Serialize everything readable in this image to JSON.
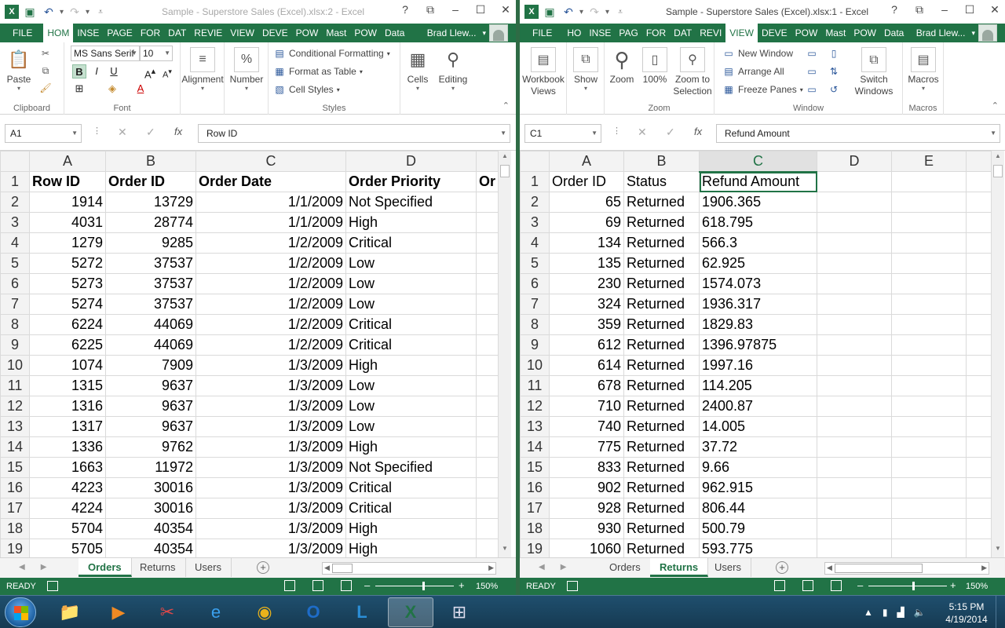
{
  "left": {
    "title": "Sample - Superstore Sales (Excel).xlsx:2 - Excel",
    "user": "Brad Llew...",
    "tabs": [
      "FILE",
      "HOM",
      "INSE",
      "PAGE",
      "FOR",
      "DAT",
      "REVIE",
      "VIEW",
      "DEVE",
      "POW",
      "Mast",
      "POW",
      "Data"
    ],
    "active_tab": "HOM",
    "ribbon": {
      "paste": "Paste",
      "clipboard": "Clipboard",
      "font_name": "MS Sans Serif",
      "font_size": "10",
      "bold": "B",
      "italic": "I",
      "underline": "U",
      "font_group": "Font",
      "alignment": "Alignment",
      "number": "Number",
      "percent": "%",
      "conditional": "Conditional Formatting",
      "format_table": "Format as Table",
      "cell_styles": "Cell Styles",
      "styles_group": "Styles",
      "cells": "Cells",
      "editing": "Editing"
    },
    "name_box": "A1",
    "formula": "Row ID",
    "columns": [
      "A",
      "B",
      "C",
      "D",
      "Or"
    ],
    "header_row": [
      "Row ID",
      "Order ID",
      "Order Date",
      "Order Priority",
      "Or"
    ],
    "rows": [
      [
        "1914",
        "13729",
        "1/1/2009",
        "Not Specified"
      ],
      [
        "4031",
        "28774",
        "1/1/2009",
        "High"
      ],
      [
        "1279",
        "9285",
        "1/2/2009",
        "Critical"
      ],
      [
        "5272",
        "37537",
        "1/2/2009",
        "Low"
      ],
      [
        "5273",
        "37537",
        "1/2/2009",
        "Low"
      ],
      [
        "5274",
        "37537",
        "1/2/2009",
        "Low"
      ],
      [
        "6224",
        "44069",
        "1/2/2009",
        "Critical"
      ],
      [
        "6225",
        "44069",
        "1/2/2009",
        "Critical"
      ],
      [
        "1074",
        "7909",
        "1/3/2009",
        "High"
      ],
      [
        "1315",
        "9637",
        "1/3/2009",
        "Low"
      ],
      [
        "1316",
        "9637",
        "1/3/2009",
        "Low"
      ],
      [
        "1317",
        "9637",
        "1/3/2009",
        "Low"
      ],
      [
        "1336",
        "9762",
        "1/3/2009",
        "High"
      ],
      [
        "1663",
        "11972",
        "1/3/2009",
        "Not Specified"
      ],
      [
        "4223",
        "30016",
        "1/3/2009",
        "Critical"
      ],
      [
        "4224",
        "30016",
        "1/3/2009",
        "Critical"
      ],
      [
        "5704",
        "40354",
        "1/3/2009",
        "High"
      ],
      [
        "5705",
        "40354",
        "1/3/2009",
        "High"
      ]
    ],
    "sheets": [
      "Orders",
      "Returns",
      "Users"
    ],
    "active_sheet": "Orders",
    "status": "READY",
    "zoom": "150%"
  },
  "right": {
    "title": "Sample - Superstore Sales (Excel).xlsx:1 - Excel",
    "user": "Brad Llew...",
    "tabs": [
      "FILE",
      "HO",
      "INSE",
      "PAG",
      "FOR",
      "DAT",
      "REVI",
      "VIEW",
      "DEVE",
      "POW",
      "Mast",
      "POW",
      "Data"
    ],
    "active_tab": "VIEW",
    "ribbon": {
      "workbook_views": "Workbook Views",
      "show": "Show",
      "zoom": "Zoom",
      "zoom100": "100%",
      "zoom_selection": "Zoom to Selection",
      "zoom_group": "Zoom",
      "new_window": "New Window",
      "arrange_all": "Arrange All",
      "freeze_panes": "Freeze Panes",
      "switch_windows": "Switch Windows",
      "window_group": "Window",
      "macros": "Macros",
      "macros_group": "Macros"
    },
    "name_box": "C1",
    "formula": "Refund Amount",
    "columns": [
      "A",
      "B",
      "C",
      "D",
      "E"
    ],
    "header_row": [
      "Order ID",
      "Status",
      "Refund Amount",
      "",
      ""
    ],
    "rows": [
      [
        "65",
        "Returned",
        "1906.365"
      ],
      [
        "69",
        "Returned",
        "618.795"
      ],
      [
        "134",
        "Returned",
        "566.3"
      ],
      [
        "135",
        "Returned",
        "62.925"
      ],
      [
        "230",
        "Returned",
        "1574.073"
      ],
      [
        "324",
        "Returned",
        "1936.317"
      ],
      [
        "359",
        "Returned",
        "1829.83"
      ],
      [
        "612",
        "Returned",
        "1396.97875"
      ],
      [
        "614",
        "Returned",
        "1997.16"
      ],
      [
        "678",
        "Returned",
        "114.205"
      ],
      [
        "710",
        "Returned",
        "2400.87"
      ],
      [
        "740",
        "Returned",
        "14.005"
      ],
      [
        "775",
        "Returned",
        "37.72"
      ],
      [
        "833",
        "Returned",
        "9.66"
      ],
      [
        "902",
        "Returned",
        "962.915"
      ],
      [
        "928",
        "Returned",
        "806.44"
      ],
      [
        "930",
        "Returned",
        "500.79"
      ],
      [
        "1060",
        "Returned",
        "593.775"
      ]
    ],
    "sheets": [
      "Orders",
      "Returns",
      "Users"
    ],
    "active_sheet": "Returns",
    "status": "READY",
    "zoom": "150%"
  },
  "taskbar": {
    "apps": [
      "file-explorer-icon",
      "media-player-icon",
      "snipping-tool-icon",
      "internet-explorer-icon",
      "chrome-icon",
      "outlook-icon",
      "lync-icon",
      "excel-icon",
      "grid-app-icon"
    ],
    "time": "5:15 PM",
    "date": "4/19/2014"
  },
  "colors": {
    "excel_green": "#217346",
    "taskbar": "#1f4f6e"
  }
}
